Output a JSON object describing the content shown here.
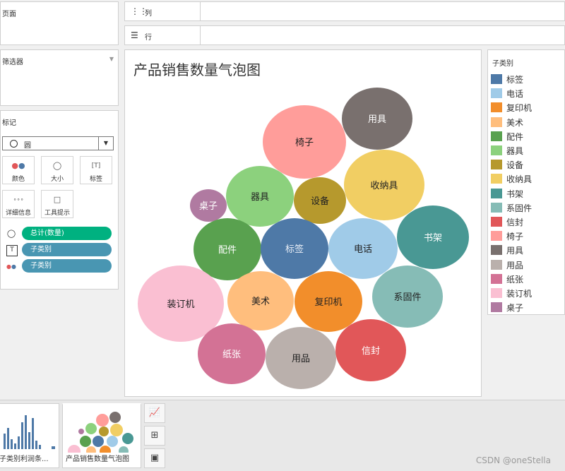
{
  "panels": {
    "pages": "页面",
    "filters": "筛选器",
    "marks": "标记"
  },
  "shelves": {
    "columns": "列",
    "rows": "行"
  },
  "marks_card": {
    "mark_type": "圆",
    "buttons": {
      "color": "颜色",
      "size": "大小",
      "label": "标签",
      "detail": "详细信息",
      "tooltip": "工具提示"
    },
    "pills": [
      {
        "text": "总计(数量)",
        "color": "#00b180",
        "icon": "size-icon"
      },
      {
        "text": "子类别",
        "color": "#4996b2",
        "icon": "label-icon"
      },
      {
        "text": "子类别",
        "color": "#4996b2",
        "icon": "color-icon"
      }
    ]
  },
  "viz": {
    "title": "产品销售数量气泡图"
  },
  "chart_data": {
    "type": "bubble",
    "title": "产品销售数量气泡图",
    "size_field": "总计(数量)",
    "label_field": "子类别",
    "bubbles": [
      {
        "label": "用具",
        "color": "#79706e"
      },
      {
        "label": "椅子",
        "color": "#ff9d9a"
      },
      {
        "label": "收纳具",
        "color": "#f1ce63"
      },
      {
        "label": "器具",
        "color": "#8cd17d"
      },
      {
        "label": "设备",
        "color": "#b6992d"
      },
      {
        "label": "桌子",
        "color": "#b07aa1"
      },
      {
        "label": "书架",
        "color": "#499894"
      },
      {
        "label": "配件",
        "color": "#59a14f"
      },
      {
        "label": "标签",
        "color": "#4e79a7"
      },
      {
        "label": "电话",
        "color": "#a0cbe8"
      },
      {
        "label": "装订机",
        "color": "#fabfd2"
      },
      {
        "label": "美术",
        "color": "#ffbe7d"
      },
      {
        "label": "复印机",
        "color": "#f28e2b"
      },
      {
        "label": "系固件",
        "color": "#86bcb6"
      },
      {
        "label": "纸张",
        "color": "#d37295"
      },
      {
        "label": "用品",
        "color": "#bab0ac"
      },
      {
        "label": "信封",
        "color": "#e15759"
      }
    ]
  },
  "legend": {
    "title": "子类别",
    "items": [
      {
        "label": "标签",
        "color": "#4e79a7"
      },
      {
        "label": "电话",
        "color": "#a0cbe8"
      },
      {
        "label": "复印机",
        "color": "#f28e2b"
      },
      {
        "label": "美术",
        "color": "#ffbe7d"
      },
      {
        "label": "配件",
        "color": "#59a14f"
      },
      {
        "label": "器具",
        "color": "#8cd17d"
      },
      {
        "label": "设备",
        "color": "#b6992d"
      },
      {
        "label": "收纳具",
        "color": "#f1ce63"
      },
      {
        "label": "书架",
        "color": "#499894"
      },
      {
        "label": "系固件",
        "color": "#86bcb6"
      },
      {
        "label": "信封",
        "color": "#e15759"
      },
      {
        "label": "椅子",
        "color": "#ff9d9a"
      },
      {
        "label": "用具",
        "color": "#79706e"
      },
      {
        "label": "用品",
        "color": "#bab0ac"
      },
      {
        "label": "纸张",
        "color": "#d37295"
      },
      {
        "label": "装订机",
        "color": "#fabfd2"
      },
      {
        "label": "桌子",
        "color": "#b07aa1"
      }
    ]
  },
  "bottom": {
    "sheets": [
      "子类别利润条...",
      "产品销售数量气泡图"
    ],
    "watermark": "CSDN @oneStella"
  }
}
